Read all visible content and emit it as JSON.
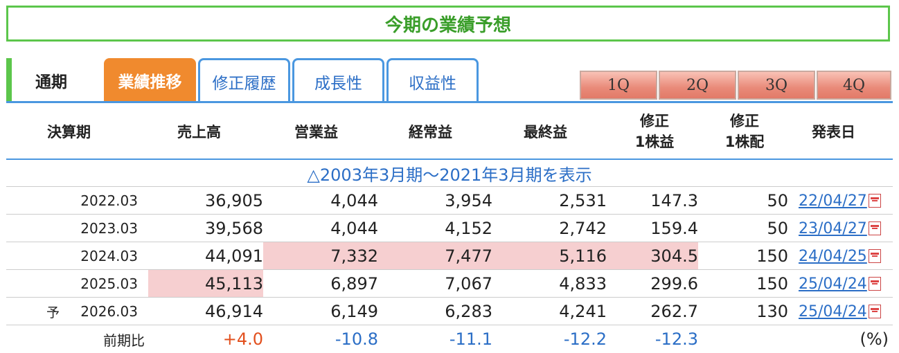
{
  "title": "今期の業績予想",
  "tabs": {
    "period_label": "通期",
    "items": [
      {
        "label": "業績推移",
        "active": true
      },
      {
        "label": "修正履歴",
        "active": false
      },
      {
        "label": "成長性",
        "active": false
      },
      {
        "label": "収益性",
        "active": false
      }
    ],
    "quarters": [
      "1Q",
      "2Q",
      "3Q",
      "4Q"
    ]
  },
  "table": {
    "headers": {
      "period": "決算期",
      "sales": "売上高",
      "operating": "営業益",
      "ordinary": "経常益",
      "net": "最終益",
      "eps_line1": "修正",
      "eps_line2": "1株益",
      "div_line1": "修正",
      "div_line2": "1株配",
      "announce": "発表日"
    },
    "show_all_link": "△2003年3月期～2021年3月期を表示",
    "rows": [
      {
        "period": "2022.03",
        "sales": "36,905",
        "operating": "4,044",
        "ordinary": "3,954",
        "net": "2,531",
        "eps": "147.3",
        "div": "50",
        "date": "22/04/27"
      },
      {
        "period": "2023.03",
        "sales": "39,568",
        "operating": "4,044",
        "ordinary": "4,152",
        "net": "2,742",
        "eps": "159.4",
        "div": "50",
        "date": "23/04/27"
      },
      {
        "period": "2024.03",
        "sales": "44,091",
        "operating": "7,332",
        "ordinary": "7,477",
        "net": "5,116",
        "eps": "304.5",
        "div": "150",
        "date": "24/04/25"
      },
      {
        "period": "2025.03",
        "sales": "45,113",
        "operating": "6,897",
        "ordinary": "7,067",
        "net": "4,833",
        "eps": "299.6",
        "div": "150",
        "date": "25/04/24"
      },
      {
        "mark": "予",
        "period": "2026.03",
        "sales": "46,914",
        "operating": "6,149",
        "ordinary": "6,283",
        "net": "4,241",
        "eps": "262.7",
        "div": "130",
        "date": "25/04/24"
      }
    ],
    "comparison": {
      "label": "前期比",
      "sales": "+4.0",
      "operating": "-10.8",
      "ordinary": "-11.1",
      "net": "-12.2",
      "eps": "-12.3",
      "unit": "(%)"
    }
  },
  "colors": {
    "accent_green": "#5cc64b",
    "tab_orange": "#f08a2e",
    "link_blue": "#2b6ec6",
    "highlight_pink": "#f6cfd0"
  }
}
